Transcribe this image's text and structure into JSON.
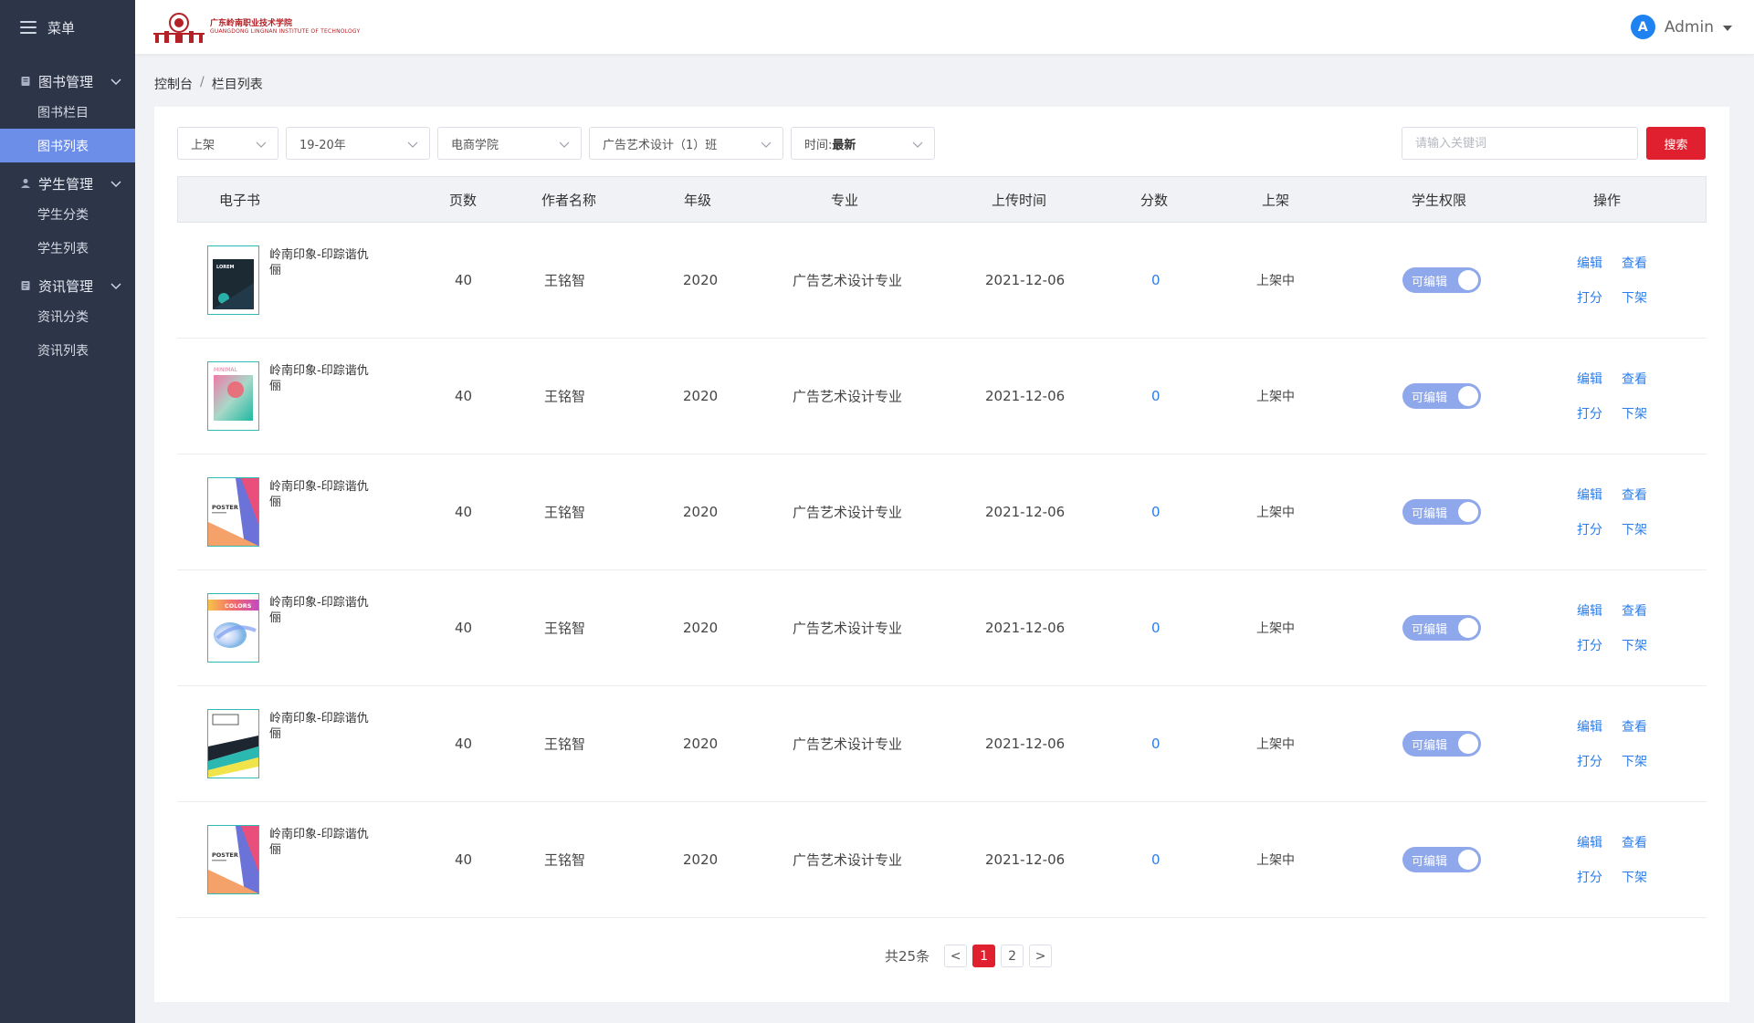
{
  "sidebar": {
    "menu_label": "菜单",
    "groups": [
      {
        "title": "图书管理",
        "items": [
          "图书栏目",
          "图书列表"
        ]
      },
      {
        "title": "学生管理",
        "items": [
          "学生分类",
          "学生列表"
        ]
      },
      {
        "title": "资讯管理",
        "items": [
          "资讯分类",
          "资讯列表"
        ]
      }
    ],
    "active_item": "图书列表"
  },
  "header": {
    "logo_cn": "广东岭南职业技术学院",
    "logo_en": "GUANGDONG LINGNAN INSTITUTE OF TECHNOLOGY",
    "avatar_letter": "A",
    "user_name": "Admin"
  },
  "breadcrumb": {
    "home": "控制台",
    "current": "栏目列表"
  },
  "filters": {
    "status": "上架",
    "year": "19-20年",
    "college": "电商学院",
    "class": "广告艺术设计（1）班",
    "time_label": "时间:",
    "time_value": "最新"
  },
  "search": {
    "placeholder": "请输入关键词",
    "button": "搜索"
  },
  "table": {
    "headers": [
      "电子书",
      "页数",
      "作者名称",
      "年级",
      "专业",
      "上传时间",
      "分数",
      "上架",
      "学生权限",
      "操作"
    ],
    "rows": [
      {
        "title": "岭南印象-印踪谐仇俪",
        "pages": "40",
        "author": "王铭智",
        "grade": "2020",
        "major": "广告艺术设计专业",
        "date": "2021-12-06",
        "score": "0",
        "status": "上架中",
        "permission": "可编辑",
        "cover": "lorem",
        "cover_text": "LOREM"
      },
      {
        "title": "岭南印象-印踪谐仇俪",
        "pages": "40",
        "author": "王铭智",
        "grade": "2020",
        "major": "广告艺术设计专业",
        "date": "2021-12-06",
        "score": "0",
        "status": "上架中",
        "permission": "可编辑",
        "cover": "minimal",
        "cover_text": "MINIMAL"
      },
      {
        "title": "岭南印象-印踪谐仇俪",
        "pages": "40",
        "author": "王铭智",
        "grade": "2020",
        "major": "广告艺术设计专业",
        "date": "2021-12-06",
        "score": "0",
        "status": "上架中",
        "permission": "可编辑",
        "cover": "poster",
        "cover_text": "POSTER"
      },
      {
        "title": "岭南印象-印踪谐仇俪",
        "pages": "40",
        "author": "王铭智",
        "grade": "2020",
        "major": "广告艺术设计专业",
        "date": "2021-12-06",
        "score": "0",
        "status": "上架中",
        "permission": "可编辑",
        "cover": "colors",
        "cover_text": "COLORS"
      },
      {
        "title": "岭南印象-印踪谐仇俪",
        "pages": "40",
        "author": "王铭智",
        "grade": "2020",
        "major": "广告艺术设计专业",
        "date": "2021-12-06",
        "score": "0",
        "status": "上架中",
        "permission": "可编辑",
        "cover": "stripes",
        "cover_text": ""
      },
      {
        "title": "岭南印象-印踪谐仇俪",
        "pages": "40",
        "author": "王铭智",
        "grade": "2020",
        "major": "广告艺术设计专业",
        "date": "2021-12-06",
        "score": "0",
        "status": "上架中",
        "permission": "可编辑",
        "cover": "poster",
        "cover_text": "POSTER"
      }
    ],
    "actions": [
      "编辑",
      "查看",
      "打分",
      "下架"
    ]
  },
  "pagination": {
    "total": "共25条",
    "prev": "<",
    "pages": [
      "1",
      "2"
    ],
    "current": "1",
    "next": ">"
  },
  "colors": {
    "sidebar": "#2d3548",
    "active": "#6c8ee8",
    "accent": "#e0202f",
    "link": "#2b7de9",
    "toggle": "#8fa8eb"
  }
}
